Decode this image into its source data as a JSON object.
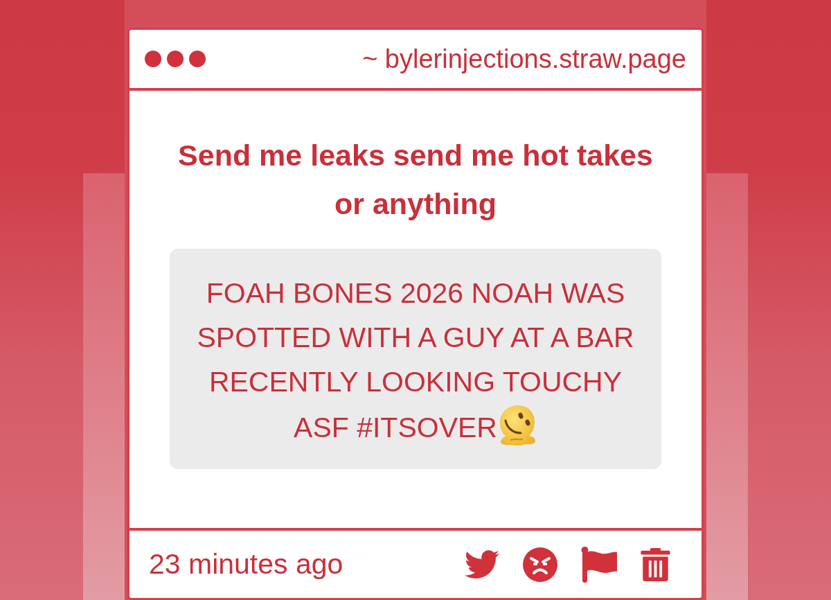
{
  "window": {
    "url": "~ bylerinjections.straw.page"
  },
  "prompt": {
    "title": "Send me leaks send me hot takes or anything"
  },
  "message": {
    "lines": [
      "FOAH BONES 2026 NOAH WAS",
      "SPOTTED WITH A GUY AT A BAR",
      "RECENTLY LOOKING TOUCHY",
      "ASF #ITSOVER"
    ]
  },
  "footer": {
    "time": "23 minutes ago",
    "actions": [
      {
        "kind": "bird"
      },
      {
        "kind": "angry"
      },
      {
        "kind": "flag"
      },
      {
        "kind": "trash"
      }
    ]
  }
}
